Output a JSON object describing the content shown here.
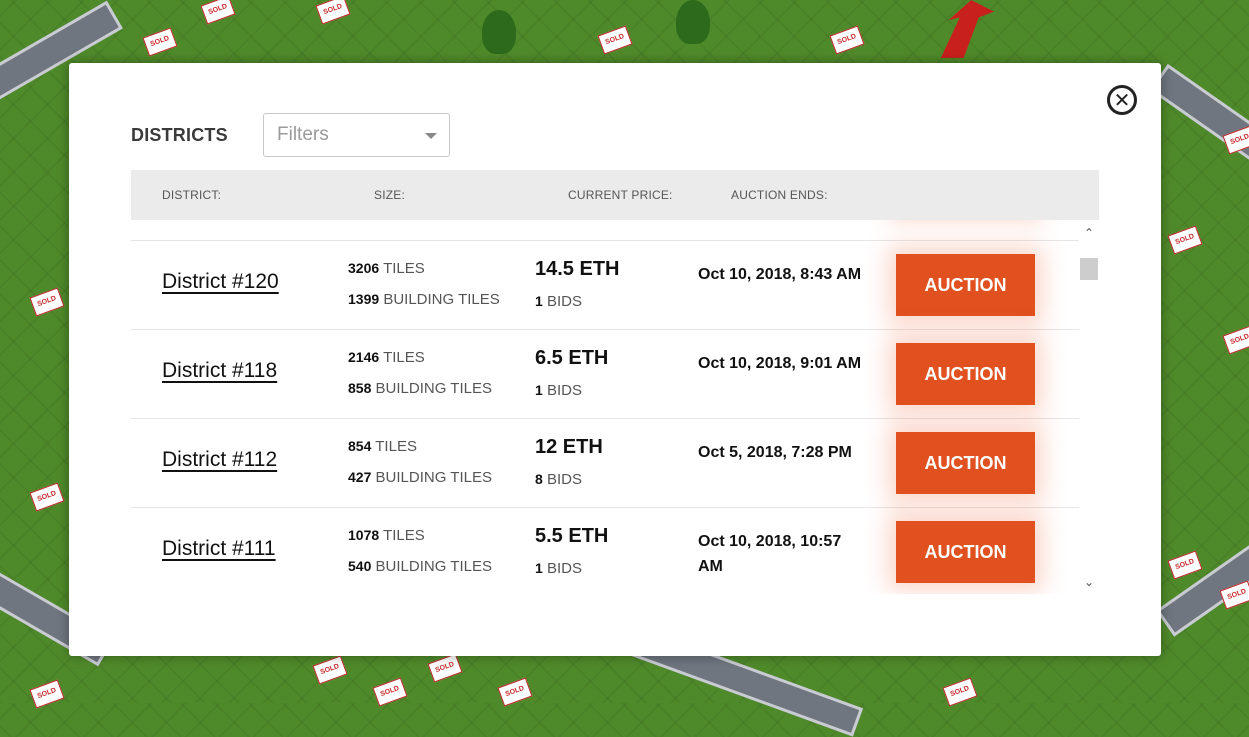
{
  "background": {
    "sign_text": "SOLD"
  },
  "modal": {
    "title": "DISTRICTS",
    "close_icon": "close-circle-icon",
    "filter": {
      "placeholder": "Filters",
      "icon": "caret-down-icon"
    },
    "table": {
      "headers": {
        "district": "DISTRICT:",
        "size": "SIZE:",
        "current_price": "CURRENT PRICE:",
        "auction_ends": "AUCTION ENDS:"
      },
      "rows": [
        {
          "name": "",
          "tiles_count": "",
          "tiles_label": "",
          "building_tiles_count": "",
          "building_tiles_label": "",
          "price": "",
          "bids_count": "",
          "bids_label": "",
          "auction_ends": "",
          "action_label": ""
        },
        {
          "name": "District #120",
          "tiles_count": "3206",
          "tiles_label": "TILES",
          "building_tiles_count": "1399",
          "building_tiles_label": "BUILDING TILES",
          "price": "14.5 ETH",
          "bids_count": "1",
          "bids_label": "BIDS",
          "auction_ends": "Oct 10, 2018, 8:43 AM",
          "action_label": "AUCTION"
        },
        {
          "name": "District #118",
          "tiles_count": "2146",
          "tiles_label": "TILES",
          "building_tiles_count": "858",
          "building_tiles_label": "BUILDING TILES",
          "price": "6.5 ETH",
          "bids_count": "1",
          "bids_label": "BIDS",
          "auction_ends": "Oct 10, 2018, 9:01 AM",
          "action_label": "AUCTION"
        },
        {
          "name": "District #112",
          "tiles_count": "854",
          "tiles_label": "TILES",
          "building_tiles_count": "427",
          "building_tiles_label": "BUILDING TILES",
          "price": "12 ETH",
          "bids_count": "8",
          "bids_label": "BIDS",
          "auction_ends": "Oct 5, 2018, 7:28 PM",
          "action_label": "AUCTION"
        },
        {
          "name": "District #111",
          "tiles_count": "1078",
          "tiles_label": "TILES",
          "building_tiles_count": "540",
          "building_tiles_label": "BUILDING TILES",
          "price": "5.5 ETH",
          "bids_count": "1",
          "bids_label": "BIDS",
          "auction_ends": "Oct 10, 2018, 10:57 AM",
          "action_label": "AUCTION"
        }
      ]
    },
    "scrollbar": {
      "up_icon": "chevron-up-icon",
      "down_icon": "chevron-down-icon"
    }
  }
}
